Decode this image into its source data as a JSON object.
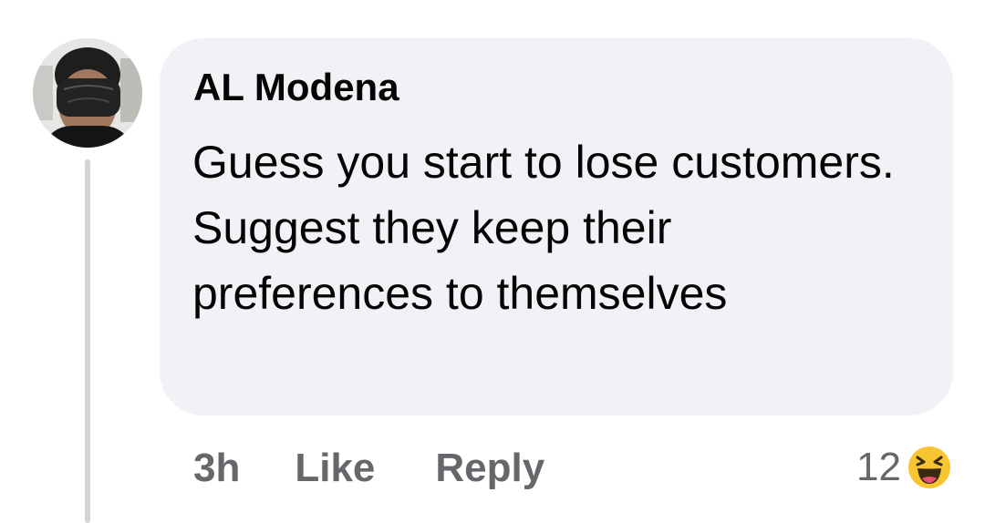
{
  "comment": {
    "author": "AL Modena",
    "text": "Guess you start to lose customers. Suggest they keep their preferences to themselves",
    "time": "3h",
    "like_label": "Like",
    "reply_label": "Reply",
    "reaction_count": "12",
    "reaction_icon": "haha-emoji-icon"
  },
  "colors": {
    "bubble_bg": "#f0f2f5",
    "text": "#050505",
    "meta_text": "#65676b",
    "thread_line": "#d3d5d9",
    "haha_yellow": "#f7c531"
  }
}
